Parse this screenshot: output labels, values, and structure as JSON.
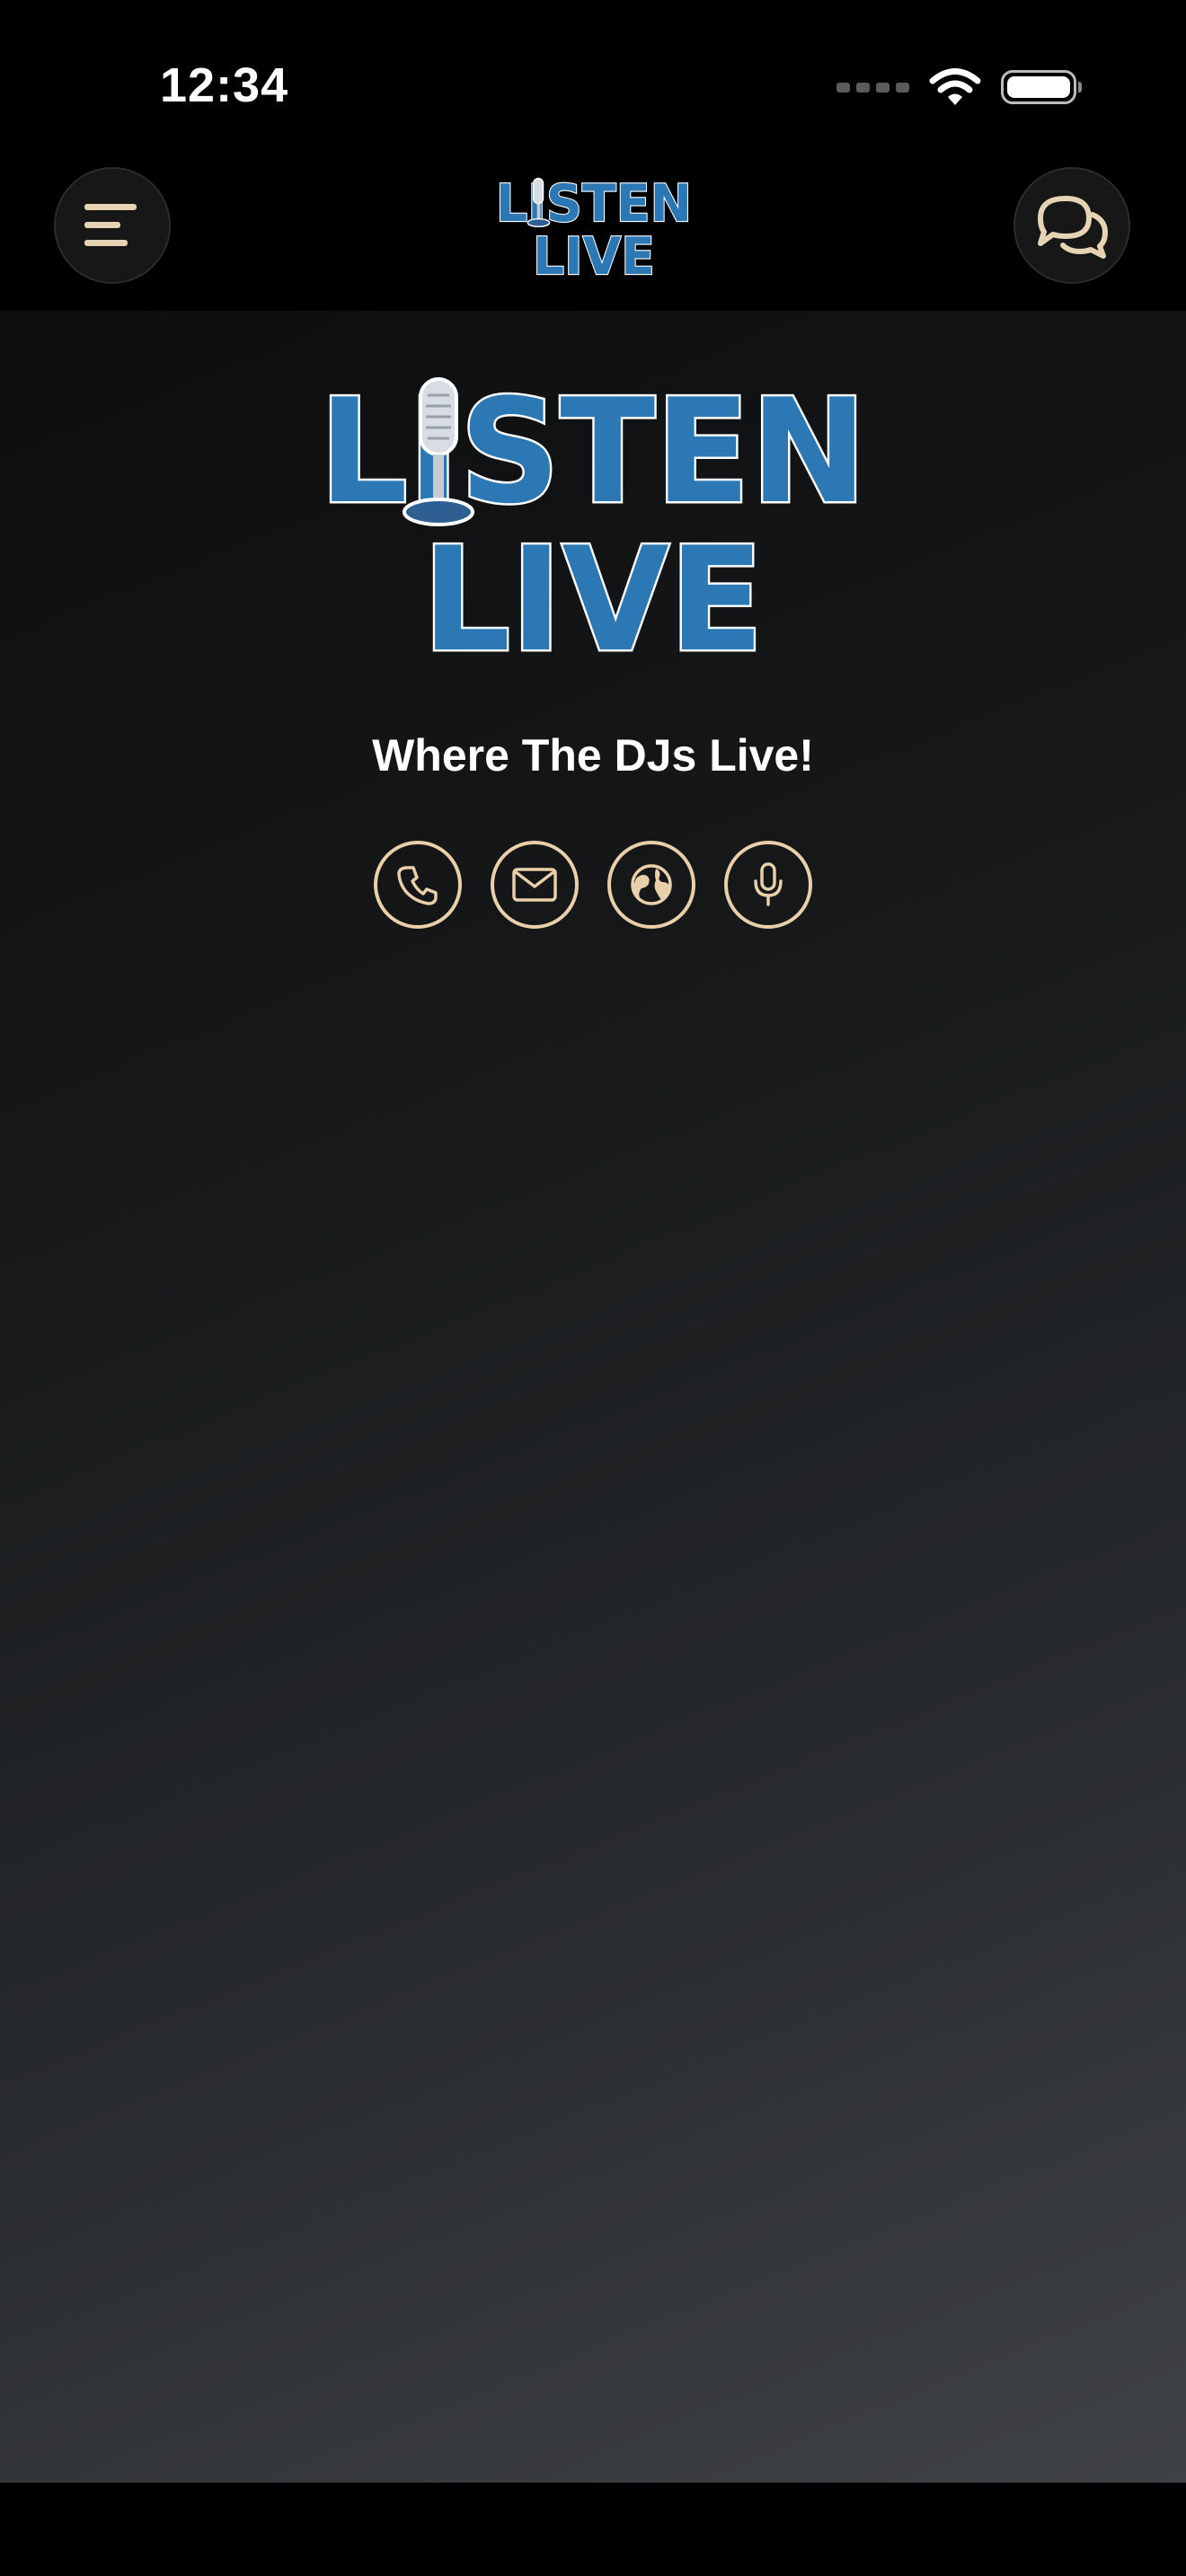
{
  "status_bar": {
    "time": "12:34"
  },
  "header": {
    "logo_line1": "LISTEN",
    "logo_line2": "LIVE",
    "menu_icon": "menu-icon",
    "chat_icon": "chat-bubbles-icon"
  },
  "main": {
    "logo_line1": "LISTEN",
    "logo_line2": "LIVE",
    "tagline": "Where The DJs Live!",
    "contact_buttons": [
      {
        "icon": "phone-icon"
      },
      {
        "icon": "mail-icon"
      },
      {
        "icon": "globe-icon"
      },
      {
        "icon": "microphone-icon"
      }
    ]
  },
  "colors": {
    "accent": "#e9cfaa",
    "logo_blue": "#2b78b5",
    "background": "#000000"
  }
}
